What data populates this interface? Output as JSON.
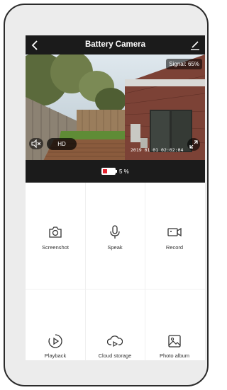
{
  "header": {
    "title": "Battery Camera",
    "back_icon": "chevron-left-icon",
    "edit_icon": "pencil-icon"
  },
  "video": {
    "signal_text": "Signal: 65%",
    "timestamp": "2019 01 01  02:02:04",
    "hd_label": "HD",
    "mute_icon": "speaker-mute-icon",
    "fullscreen_icon": "expand-icon"
  },
  "battery": {
    "level": 0.05,
    "text": "5 %",
    "color": "#e5232f"
  },
  "actions": [
    {
      "label": "Screenshot",
      "icon": "camera-icon"
    },
    {
      "label": "Speak",
      "icon": "microphone-icon"
    },
    {
      "label": "Record",
      "icon": "video-camera-icon"
    },
    {
      "label": "Playback",
      "icon": "playback-icon"
    },
    {
      "label": "Cloud storage",
      "icon": "cloud-icon"
    },
    {
      "label": "Photo album",
      "icon": "image-icon"
    }
  ]
}
